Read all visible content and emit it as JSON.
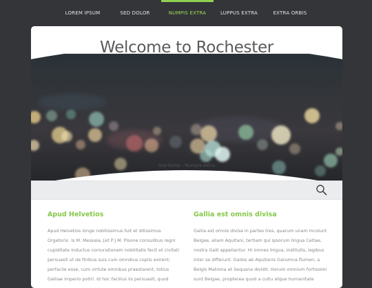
{
  "nav": {
    "items": [
      {
        "label": "LOREM IPSUM"
      },
      {
        "label": "SED DOLOR"
      },
      {
        "label": "NUMPIS EXTRA"
      },
      {
        "label": "LUPPUS EXTRA"
      },
      {
        "label": "EXTRA ORBIS"
      }
    ],
    "active_index": 2
  },
  "colors": {
    "accent": "#8fd14f",
    "background": "#333538",
    "heading": "#86c84a"
  },
  "page": {
    "title": "Welcome to Rochester",
    "breadcrumb": "Startseite - Numpis extra"
  },
  "search": {
    "icon": "search-icon"
  },
  "columns": [
    {
      "heading": "Apud Helvetios",
      "lines": [
        "Apud Helvetios longe nobilissimus fuit et ditissimus",
        "Orgetorix. Is M. Messala, [et P.] M. Pisone consulibus regni",
        "cupiditate inductus coniurationem nobilitatis fecit et civitati",
        "persuasit ut de finibus suis cum omnibus copiis exirent:",
        "perfacile esse, cum virtute omnibus praestarent, totius",
        "Galliae imperio potiri. Id hoc facilius iis persuasit, quod"
      ]
    },
    {
      "heading": "Gallia est omnis divisa",
      "lines": [
        "Gallia est omnis divisa in partes tres, quarum unam incolunt",
        "Belgae, aliam Aquitani, tertiam qui ipsorum lingua Celtae,",
        "nostra Galli appellantur. Hi omnes lingua, institutis, legibus",
        "inter se differunt. Gallos ab Aquitanis Garumna flumen, a",
        "Belgis Matrona et Sequana dividit. Horum omnium fortissimi",
        "sunt Belgae, propterea quod a cultu atque humanitate"
      ]
    }
  ]
}
